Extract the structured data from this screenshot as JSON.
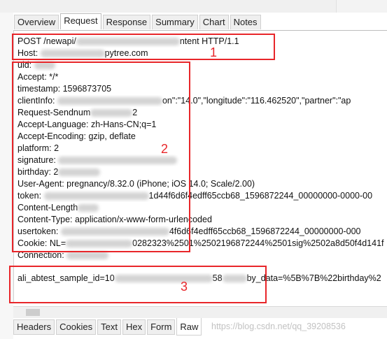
{
  "tabs": [
    {
      "label": "Overview"
    },
    {
      "label": "Request"
    },
    {
      "label": "Response"
    },
    {
      "label": "Summary"
    },
    {
      "label": "Chart"
    },
    {
      "label": "Notes"
    }
  ],
  "headers": {
    "request_line_a": "POST /newapi/",
    "request_line_b": "ntent HTTP/1.1",
    "host_label": "Host: ",
    "host_tail": "pytree.com",
    "uid": "uid: ",
    "accept": "Accept: */*",
    "timestamp": "timestamp: 1596873705",
    "clientinfo_a": "clientInfo: ",
    "clientinfo_b": "on\":\"14.0\",\"longitude\":\"116.462520\",\"partner\":\"ap",
    "sendnumber_a": "Request-Sendnum",
    "sendnumber_b": "2",
    "accept_language": "Accept-Language: zh-Hans-CN;q=1",
    "accept_encoding": "Accept-Encoding: gzip, deflate",
    "platform": "platform: 2",
    "signature": "signature: ",
    "birthday": "birthday: 2",
    "user_agent": "User-Agent: pregnancy/8.32.0 (iPhone; iOS 14.0; Scale/2.00)",
    "token_a": "token: ",
    "token_b": "1d44f6d6f4edff65ccb68_1596872244_00000000-0000-00",
    "content_length": "Content-Length",
    "content_type": "Content-Type: application/x-www-form-urlencoded",
    "usertoken_a": "usertoken: ",
    "usertoken_b": "4f6d6f4edff65ccb68_1596872244_00000000-000",
    "cookie_a": "Cookie: NL=",
    "cookie_b": "0282323%2501%2502196872244%2501sig%2502a8d50f4d141f",
    "connection": "Connection: "
  },
  "body": {
    "line_a": "ali_abtest_sample_id=10",
    "line_b": "58",
    "line_c": "by_data=%5B%7B%22birthday%2"
  },
  "annotations": [
    "1",
    "2",
    "3"
  ],
  "bottom_tabs": [
    {
      "label": "Headers"
    },
    {
      "label": "Cookies"
    },
    {
      "label": "Text"
    },
    {
      "label": "Hex"
    },
    {
      "label": "Form"
    },
    {
      "label": "Raw"
    }
  ],
  "watermark": "https://blog.csdn.net/qq_39208536",
  "colors": {
    "annotation": "#e8262a"
  }
}
